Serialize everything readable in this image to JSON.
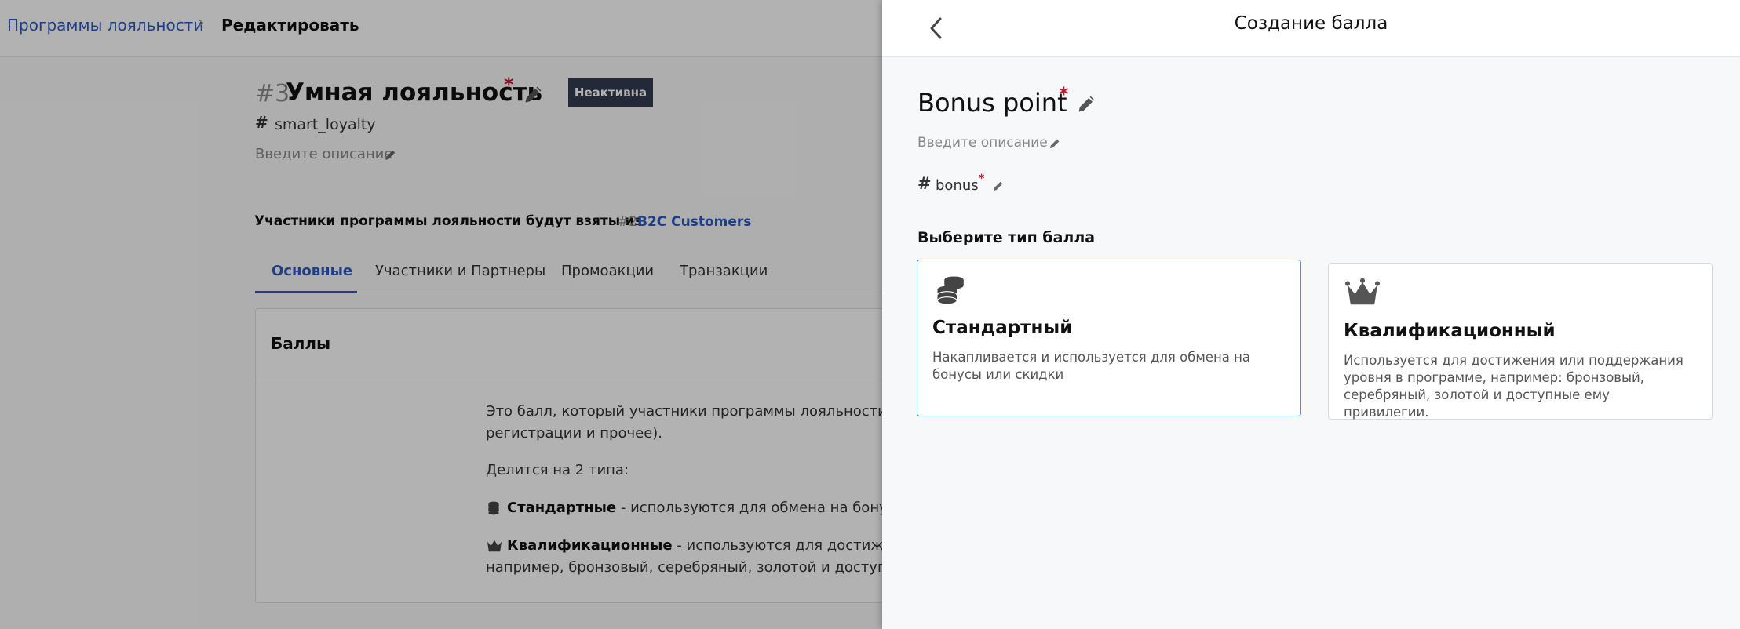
{
  "breadcrumb": {
    "parent": "Программы лояльности",
    "separator": "›",
    "current": "Редактировать"
  },
  "program": {
    "id": "#3",
    "title": "Умная лояльность",
    "required_mark": "*",
    "status_badge": "Неактивна",
    "code": "smart_loyalty",
    "description_placeholder": "Введите описание",
    "members_label": "Участники программы лояльности будут взяты из:",
    "members_source_id": "#2",
    "members_source_name": "B2C Customers"
  },
  "tabs": [
    {
      "label": "Основные",
      "active": true
    },
    {
      "label": "Участники и Партнеры",
      "active": false
    },
    {
      "label": "Промоакции",
      "active": false
    },
    {
      "label": "Транзакции",
      "active": false
    }
  ],
  "points_section": {
    "title": "Баллы",
    "line1": "Это балл, который участники программы лояльности могут",
    "line2": "регистрации и прочее).",
    "line3": "Делится на 2 типа:",
    "standard_bold": "Стандартные",
    "standard_rest": " - используются для обмена на бонусы или",
    "qual_bold": "Квалификационные",
    "qual_rest": " - используются для достижения ил",
    "qual_line2": "например, бронзовый, серебряный, золотой и доступные ем"
  },
  "drawer": {
    "title": "Создание балла",
    "point_name": "Bonus point",
    "required_mark": "*",
    "description_placeholder": "Введите описание",
    "code": "bonus",
    "choose_type_label": "Выберите тип балла",
    "types": [
      {
        "title": "Стандартный",
        "description": "Накапливается и используется для обмена на бонусы или скидки",
        "selected": true,
        "icon": "coins-icon"
      },
      {
        "title": "Квалификационный",
        "description": "Используется для достижения или поддержания уровня в программе, например: бронзовый, серебряный, золотой и доступные ему привилегии.",
        "selected": false,
        "icon": "crown-icon"
      }
    ]
  },
  "colors": {
    "accent": "#2b59c3",
    "required": "#c0142b",
    "badge_bg": "#333b4e",
    "selected_border": "#4a90d9"
  }
}
